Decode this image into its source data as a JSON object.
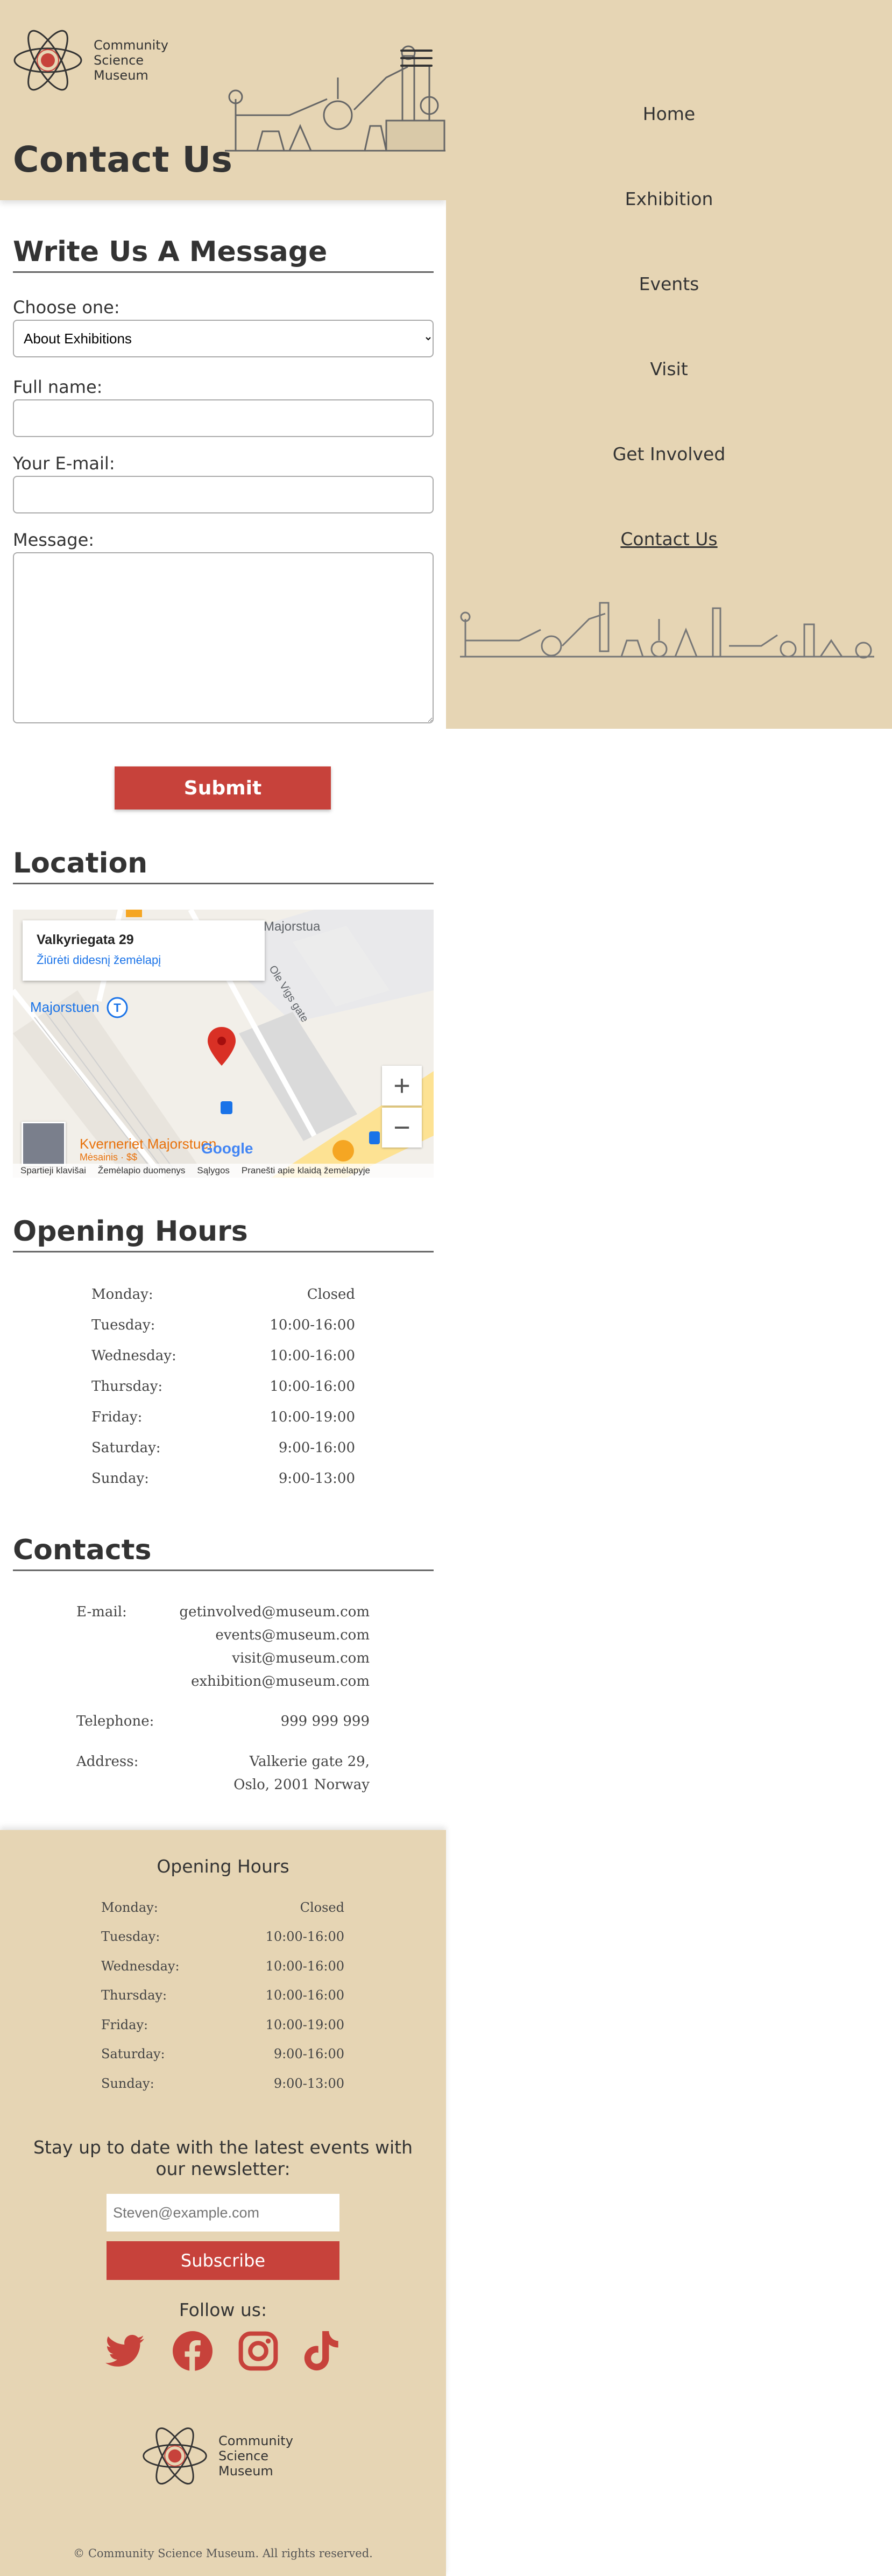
{
  "brand": {
    "line1": "Community",
    "line2": "Science",
    "line3": "Museum"
  },
  "header": {
    "page_title": "Contact Us"
  },
  "nav": {
    "items": [
      "Home",
      "Exhibition",
      "Events",
      "Visit",
      "Get Involved",
      "Contact Us"
    ],
    "active": "Contact Us"
  },
  "form": {
    "section_title": "Write Us A Message",
    "choose_label": "Choose one:",
    "choose_value": "About Exhibitions",
    "name_label": "Full name:",
    "email_label": "Your E-mail:",
    "message_label": "Message:",
    "submit_label": "Submit"
  },
  "location": {
    "section_title": "Location",
    "card_title": "Valkyriegata 29",
    "card_link": "Žiūrėti didesnį žemėlapį",
    "street1": "Majorstua",
    "street2": "Ole Vigs gate",
    "station": "Majorstuen",
    "place_name": "Kverneriet Majorstuen",
    "place_sub": "Mėsainis · $$",
    "google": "Google",
    "footer": [
      "Spartieji klavišai",
      "Žemėlapio duomenys",
      "Sąlygos",
      "Pranešti apie klaidą žemėlapyje"
    ]
  },
  "hours": {
    "section_title": "Opening Hours",
    "rows": [
      {
        "day": "Monday:",
        "time": "Closed"
      },
      {
        "day": "Tuesday:",
        "time": "10:00-16:00"
      },
      {
        "day": "Wednesday:",
        "time": "10:00-16:00"
      },
      {
        "day": "Thursday:",
        "time": "10:00-16:00"
      },
      {
        "day": "Friday:",
        "time": "10:00-19:00"
      },
      {
        "day": "Saturday:",
        "time": "9:00-16:00"
      },
      {
        "day": "Sunday:",
        "time": "9:00-13:00"
      }
    ]
  },
  "contacts": {
    "section_title": "Contacts",
    "email_label": "E-mail:",
    "emails": [
      "getinvolved@museum.com",
      "events@museum.com",
      "visit@museum.com",
      "exhibition@museum.com"
    ],
    "phone_label": "Telephone:",
    "phone": "999 999 999",
    "address_label": "Address:",
    "address1": "Valkerie gate 29,",
    "address2": "Oslo, 2001 Norway"
  },
  "footer": {
    "hours_title": "Opening Hours",
    "newsletter_text": "Stay up to date with the latest events with our newsletter:",
    "newsletter_placeholder": "Steven@example.com",
    "subscribe_label": "Subscribe",
    "follow_label": "Follow us:",
    "social": [
      "twitter-icon",
      "facebook-icon",
      "instagram-icon",
      "tiktok-icon"
    ],
    "copyright": "© Community Science Museum. All rights reserved."
  },
  "colors": {
    "beige": "#e6d5b4",
    "accent_red": "#c7423b",
    "text": "#333333"
  }
}
